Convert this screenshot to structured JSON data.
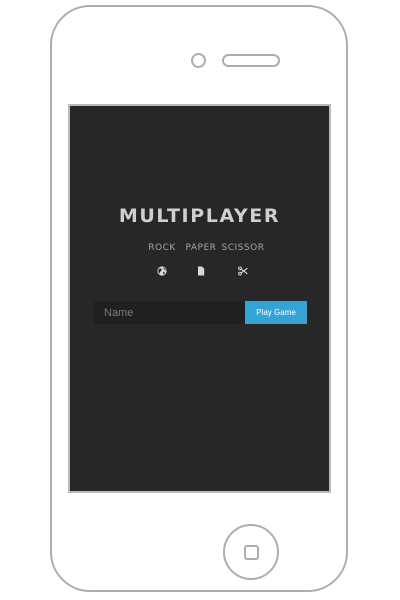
{
  "device": {
    "frame_color": "#a9aeb1",
    "screen_background": "#272727"
  },
  "game": {
    "title": "MULTIPLAYER",
    "choices": [
      {
        "label": "ROCK",
        "icon": "globe-icon"
      },
      {
        "label": "PAPER",
        "icon": "document-icon"
      },
      {
        "label": "SCISSOR",
        "icon": "scissors-icon"
      }
    ],
    "name_input": {
      "placeholder": "Name",
      "value": ""
    },
    "play_button": {
      "label": "Play Game",
      "color": "#34a4d6"
    }
  }
}
